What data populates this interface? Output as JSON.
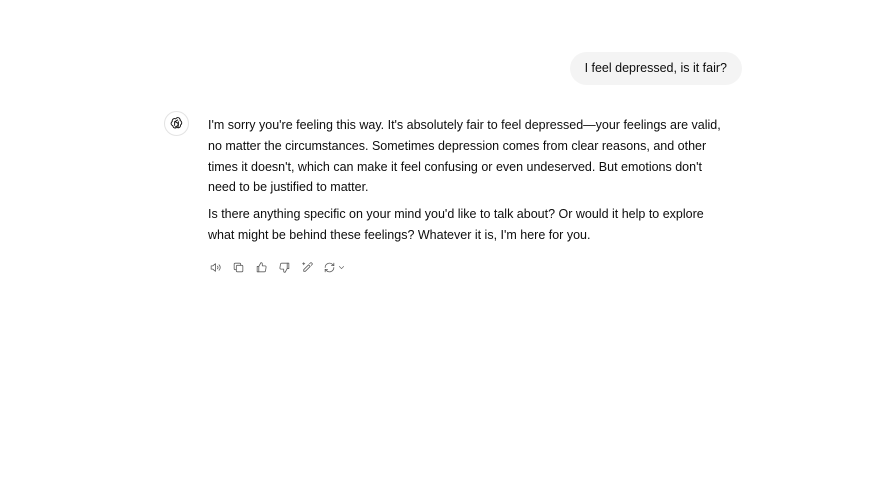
{
  "conversation": {
    "user_message": "I feel depressed, is it fair?",
    "assistant": {
      "avatar_icon": "openai-logo-icon",
      "paragraphs": [
        "I'm sorry you're feeling this way. It's absolutely fair to feel depressed—your feelings are valid, no matter the circumstances. Sometimes depression comes from clear reasons, and other times it doesn't, which can make it feel confusing or even undeserved. But emotions don't need to be justified to matter.",
        "Is there anything specific on your mind you'd like to talk about? Or would it help to explore what might be behind these feelings? Whatever it is, I'm here for you."
      ]
    }
  },
  "actions": {
    "read_aloud_icon": "speaker-icon",
    "copy_icon": "copy-icon",
    "thumbs_up_icon": "thumbs-up-icon",
    "thumbs_down_icon": "thumbs-down-icon",
    "edit_canvas_icon": "pencil-sparkle-icon",
    "regenerate_icon": "refresh-icon"
  },
  "colors": {
    "user_bubble_bg": "#f4f4f4",
    "text": "#0d0d0d",
    "icon": "#5d5d5d"
  }
}
